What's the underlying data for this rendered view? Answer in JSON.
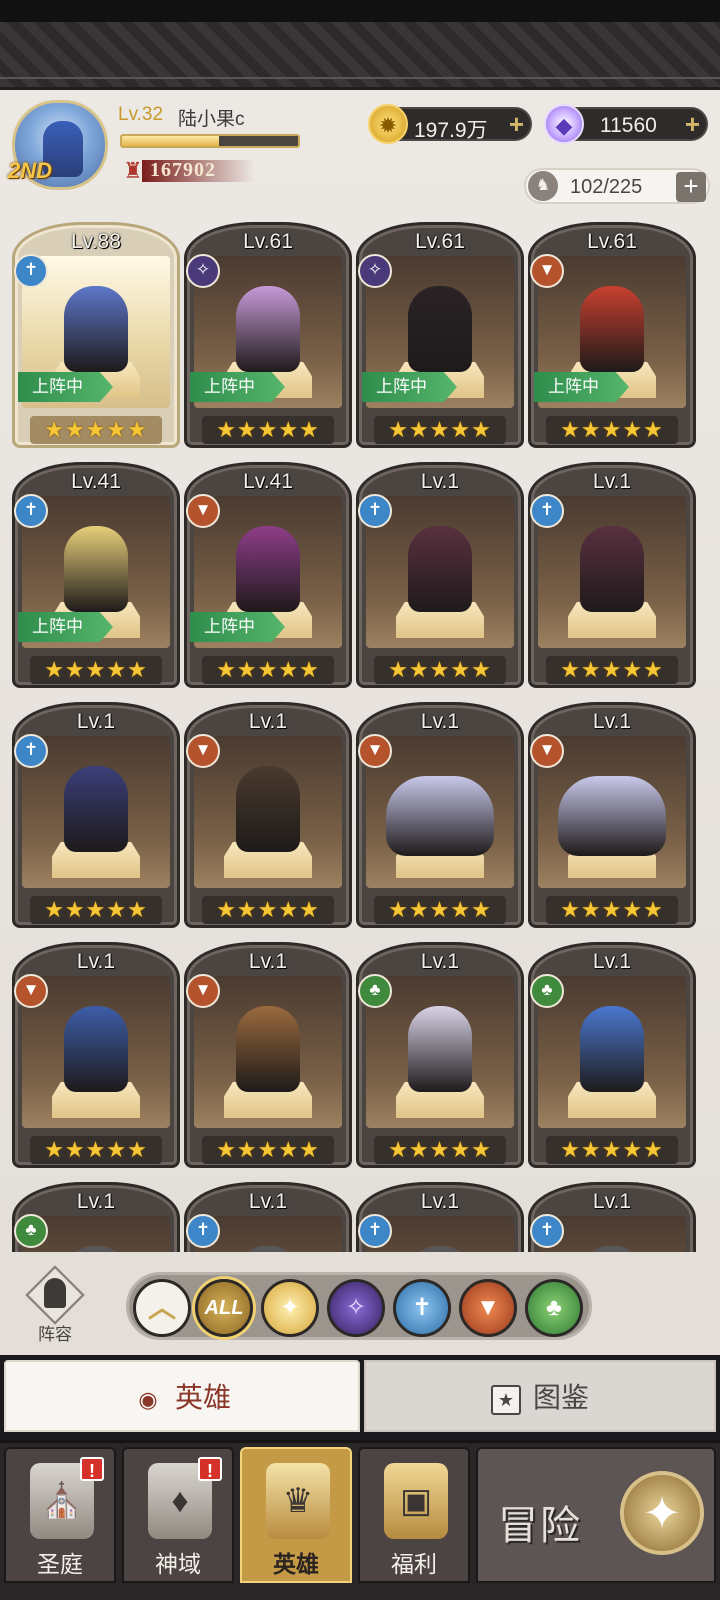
{
  "player": {
    "rank_badge": "2ND",
    "level": "Lv.32",
    "name": "陆小果c",
    "xp_fraction": 0.55,
    "power": "167902"
  },
  "currencies": {
    "gold": "197.9万",
    "gems": "11560",
    "hero_capacity": "102/225"
  },
  "heroes": [
    {
      "level": "Lv.88",
      "faction": "holy",
      "deployed": true,
      "stars": "★★★★★",
      "featured": true,
      "color": "#5d77c9"
    },
    {
      "level": "Lv.61",
      "faction": "dark",
      "deployed": true,
      "stars": "★★★★★",
      "color": "#c89ad8"
    },
    {
      "level": "Lv.61",
      "faction": "dark",
      "deployed": true,
      "stars": "★★★★★",
      "color": "#2a2326"
    },
    {
      "level": "Lv.61",
      "faction": "beast",
      "deployed": true,
      "stars": "★★★★★",
      "color": "#c8402f"
    },
    {
      "level": "Lv.41",
      "faction": "holy",
      "deployed": true,
      "stars": "★★★★★",
      "color": "#e8cf7a"
    },
    {
      "level": "Lv.41",
      "faction": "beast",
      "deployed": true,
      "stars": "★★★★★",
      "color": "#8f3d8a"
    },
    {
      "level": "Lv.1",
      "faction": "holy",
      "deployed": false,
      "stars": "★★★★★",
      "color": "#5a3040"
    },
    {
      "level": "Lv.1",
      "faction": "holy",
      "deployed": false,
      "stars": "★★★★★",
      "color": "#5a3040"
    },
    {
      "level": "Lv.1",
      "faction": "holy",
      "deployed": false,
      "stars": "★★★★★",
      "color": "#3a3f7a"
    },
    {
      "level": "Lv.1",
      "faction": "beast",
      "deployed": false,
      "stars": "★★★★★",
      "color": "#4a3a2e"
    },
    {
      "level": "Lv.1",
      "faction": "beast",
      "deployed": false,
      "stars": "★★★★★",
      "color": "#c8c8ea",
      "wide": true
    },
    {
      "level": "Lv.1",
      "faction": "beast",
      "deployed": false,
      "stars": "★★★★★",
      "color": "#c8c8ea",
      "wide": true
    },
    {
      "level": "Lv.1",
      "faction": "beast",
      "deployed": false,
      "stars": "★★★★★",
      "color": "#3d5ea8"
    },
    {
      "level": "Lv.1",
      "faction": "beast",
      "deployed": false,
      "stars": "★★★★★",
      "color": "#9a6a3e"
    },
    {
      "level": "Lv.1",
      "faction": "nature",
      "deployed": false,
      "stars": "★★★★★",
      "color": "#d8d2e6"
    },
    {
      "level": "Lv.1",
      "faction": "nature",
      "deployed": false,
      "stars": "★★★★★",
      "color": "#4a78cf"
    },
    {
      "level": "Lv.1",
      "faction": "nature",
      "deployed": false,
      "stars": "",
      "color": "#5a5a5a"
    },
    {
      "level": "Lv.1",
      "faction": "holy",
      "deployed": false,
      "stars": "",
      "color": "#5a5a5a"
    },
    {
      "level": "Lv.1",
      "faction": "holy",
      "deployed": false,
      "stars": "",
      "color": "#5a5a5a"
    },
    {
      "level": "Lv.1",
      "faction": "holy",
      "deployed": false,
      "stars": "",
      "color": "#5a5a5a"
    }
  ],
  "deployed_label": "上阵中",
  "lineup_label": "阵容",
  "filters": {
    "all_label": "ALL",
    "collapse_icon": "chevron-up-icon",
    "factions": [
      "light",
      "dark",
      "holy",
      "beast",
      "nature"
    ]
  },
  "tabs": {
    "heroes": "英雄",
    "codex": "图鉴"
  },
  "nav": {
    "court": "圣庭",
    "divine": "神域",
    "heroes": "英雄",
    "welfare": "福利",
    "adventure": "冒险",
    "alert_mark": "!"
  },
  "colors": {
    "deployed_tag": "#3a9a55",
    "star": "#f6c634",
    "selected_tab_text": "#8a3628"
  }
}
